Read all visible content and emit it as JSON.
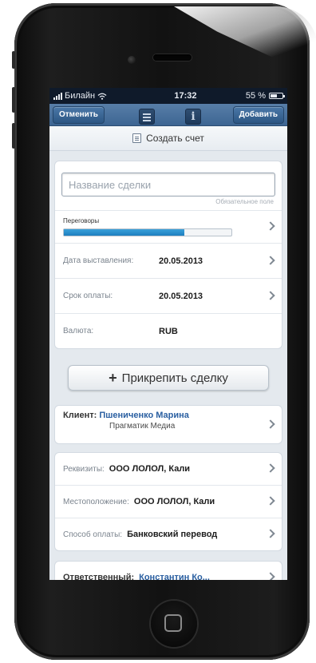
{
  "status_bar": {
    "carrier": "Билайн",
    "time": "17:32",
    "battery": "55 %",
    "battery_level": 0.55
  },
  "navbar": {
    "cancel_label": "Отменить",
    "add_label": "Добавить",
    "info_glyph": "i"
  },
  "header": {
    "title": "Создать счет"
  },
  "form": {
    "deal_placeholder": "Название сделки",
    "required_hint": "Обязательное поле",
    "stage_label": "Переговоры",
    "stage_progress": 0.72,
    "date_issued_label": "Дата выставления:",
    "date_issued_value": "20.05.2013",
    "due_label": "Срок оплаты:",
    "due_value": "20.05.2013",
    "currency_label": "Валюта:",
    "currency_value": "RUB"
  },
  "attach_button": {
    "plus": "+",
    "label": "Прикрепить сделку"
  },
  "client": {
    "label": "Клиент:",
    "name": "Пшениченко Марина",
    "company": "Прагматик Медиа"
  },
  "details": {
    "requisites_label": "Реквизиты:",
    "requisites_value": "ООО ЛОЛОЛ, Кали",
    "location_label": "Местоположение:",
    "location_value": "ООО ЛОЛОЛ, Кали",
    "payment_label": "Способ оплаты:",
    "payment_value": "Банковский перевод"
  },
  "responsible": {
    "label": "Ответственный:",
    "value": "Константин Ко..."
  }
}
